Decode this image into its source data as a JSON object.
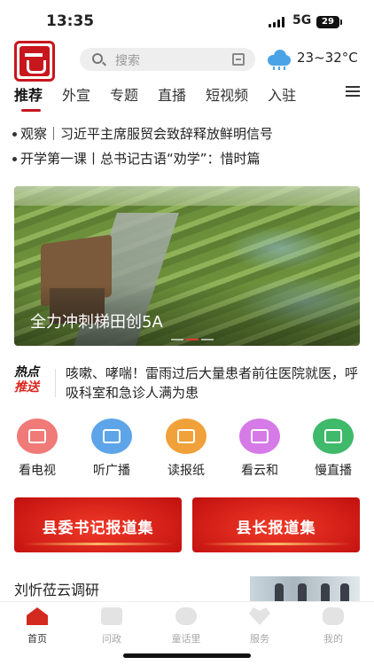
{
  "status_bar": {
    "time": "13:35",
    "network": "5G",
    "battery": "29"
  },
  "header": {
    "search_placeholder": "搜索",
    "weather": {
      "icon": "rain-cloud-icon",
      "temperature": "23~32°C"
    }
  },
  "tabs": [
    {
      "label": "推荐",
      "active": true
    },
    {
      "label": "外宣"
    },
    {
      "label": "专题"
    },
    {
      "label": "直播"
    },
    {
      "label": "短视频"
    },
    {
      "label": "入驻"
    }
  ],
  "headlines": [
    "观察｜习近平主席服贸会致辞释放鲜明信号",
    "开学第一课丨总书记古语“劝学”：惜时篇"
  ],
  "banner": {
    "caption": "全力冲刺梯田创5A",
    "page_count": 3,
    "active_index": 1
  },
  "hot_news": {
    "badge_line1": "热点",
    "badge_line2": "推送",
    "text": "咳嗽、哮喘！雷雨过后大量患者前往医院就医，呼吸科室和急诊人满为患"
  },
  "quick_links": [
    {
      "label": "看电视",
      "icon": "tv-icon",
      "color": "#f07a78"
    },
    {
      "label": "听广播",
      "icon": "radio-icon",
      "color": "#5da5e8"
    },
    {
      "label": "读报纸",
      "icon": "newspaper-icon",
      "color": "#f0a13a"
    },
    {
      "label": "看云和",
      "icon": "picture-icon",
      "color": "#d67ae8"
    },
    {
      "label": "慢直播",
      "icon": "camera-icon",
      "color": "#3fb96a"
    }
  ],
  "report_buttons": [
    "县委书记报道集",
    "县长报道集"
  ],
  "news_item": {
    "title": "刘忻莅云调研"
  },
  "bottom_nav": [
    {
      "label": "首页",
      "icon": "home-icon",
      "active": true
    },
    {
      "label": "问政",
      "icon": "book-icon"
    },
    {
      "label": "童话里",
      "icon": "cloud-icon"
    },
    {
      "label": "服务",
      "icon": "heart-icon"
    },
    {
      "label": "我的",
      "icon": "user-icon"
    }
  ]
}
